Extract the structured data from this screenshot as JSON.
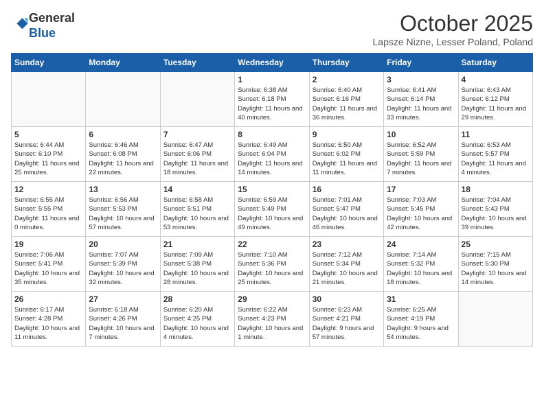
{
  "header": {
    "logo_line1": "General",
    "logo_line2": "Blue",
    "month_title": "October 2025",
    "subtitle": "Lapsze Nizne, Lesser Poland, Poland"
  },
  "weekdays": [
    "Sunday",
    "Monday",
    "Tuesday",
    "Wednesday",
    "Thursday",
    "Friday",
    "Saturday"
  ],
  "weeks": [
    [
      {
        "day": "",
        "info": ""
      },
      {
        "day": "",
        "info": ""
      },
      {
        "day": "",
        "info": ""
      },
      {
        "day": "1",
        "info": "Sunrise: 6:38 AM\nSunset: 6:18 PM\nDaylight: 11 hours\nand 40 minutes."
      },
      {
        "day": "2",
        "info": "Sunrise: 6:40 AM\nSunset: 6:16 PM\nDaylight: 11 hours\nand 36 minutes."
      },
      {
        "day": "3",
        "info": "Sunrise: 6:41 AM\nSunset: 6:14 PM\nDaylight: 11 hours\nand 33 minutes."
      },
      {
        "day": "4",
        "info": "Sunrise: 6:43 AM\nSunset: 6:12 PM\nDaylight: 11 hours\nand 29 minutes."
      }
    ],
    [
      {
        "day": "5",
        "info": "Sunrise: 6:44 AM\nSunset: 6:10 PM\nDaylight: 11 hours\nand 25 minutes."
      },
      {
        "day": "6",
        "info": "Sunrise: 6:46 AM\nSunset: 6:08 PM\nDaylight: 11 hours\nand 22 minutes."
      },
      {
        "day": "7",
        "info": "Sunrise: 6:47 AM\nSunset: 6:06 PM\nDaylight: 11 hours\nand 18 minutes."
      },
      {
        "day": "8",
        "info": "Sunrise: 6:49 AM\nSunset: 6:04 PM\nDaylight: 11 hours\nand 14 minutes."
      },
      {
        "day": "9",
        "info": "Sunrise: 6:50 AM\nSunset: 6:02 PM\nDaylight: 11 hours\nand 11 minutes."
      },
      {
        "day": "10",
        "info": "Sunrise: 6:52 AM\nSunset: 5:59 PM\nDaylight: 11 hours\nand 7 minutes."
      },
      {
        "day": "11",
        "info": "Sunrise: 6:53 AM\nSunset: 5:57 PM\nDaylight: 11 hours\nand 4 minutes."
      }
    ],
    [
      {
        "day": "12",
        "info": "Sunrise: 6:55 AM\nSunset: 5:55 PM\nDaylight: 11 hours\nand 0 minutes."
      },
      {
        "day": "13",
        "info": "Sunrise: 6:56 AM\nSunset: 5:53 PM\nDaylight: 10 hours\nand 57 minutes."
      },
      {
        "day": "14",
        "info": "Sunrise: 6:58 AM\nSunset: 5:51 PM\nDaylight: 10 hours\nand 53 minutes."
      },
      {
        "day": "15",
        "info": "Sunrise: 6:59 AM\nSunset: 5:49 PM\nDaylight: 10 hours\nand 49 minutes."
      },
      {
        "day": "16",
        "info": "Sunrise: 7:01 AM\nSunset: 5:47 PM\nDaylight: 10 hours\nand 46 minutes."
      },
      {
        "day": "17",
        "info": "Sunrise: 7:03 AM\nSunset: 5:45 PM\nDaylight: 10 hours\nand 42 minutes."
      },
      {
        "day": "18",
        "info": "Sunrise: 7:04 AM\nSunset: 5:43 PM\nDaylight: 10 hours\nand 39 minutes."
      }
    ],
    [
      {
        "day": "19",
        "info": "Sunrise: 7:06 AM\nSunset: 5:41 PM\nDaylight: 10 hours\nand 35 minutes."
      },
      {
        "day": "20",
        "info": "Sunrise: 7:07 AM\nSunset: 5:39 PM\nDaylight: 10 hours\nand 32 minutes."
      },
      {
        "day": "21",
        "info": "Sunrise: 7:09 AM\nSunset: 5:38 PM\nDaylight: 10 hours\nand 28 minutes."
      },
      {
        "day": "22",
        "info": "Sunrise: 7:10 AM\nSunset: 5:36 PM\nDaylight: 10 hours\nand 25 minutes."
      },
      {
        "day": "23",
        "info": "Sunrise: 7:12 AM\nSunset: 5:34 PM\nDaylight: 10 hours\nand 21 minutes."
      },
      {
        "day": "24",
        "info": "Sunrise: 7:14 AM\nSunset: 5:32 PM\nDaylight: 10 hours\nand 18 minutes."
      },
      {
        "day": "25",
        "info": "Sunrise: 7:15 AM\nSunset: 5:30 PM\nDaylight: 10 hours\nand 14 minutes."
      }
    ],
    [
      {
        "day": "26",
        "info": "Sunrise: 6:17 AM\nSunset: 4:28 PM\nDaylight: 10 hours\nand 11 minutes."
      },
      {
        "day": "27",
        "info": "Sunrise: 6:18 AM\nSunset: 4:26 PM\nDaylight: 10 hours\nand 7 minutes."
      },
      {
        "day": "28",
        "info": "Sunrise: 6:20 AM\nSunset: 4:25 PM\nDaylight: 10 hours\nand 4 minutes."
      },
      {
        "day": "29",
        "info": "Sunrise: 6:22 AM\nSunset: 4:23 PM\nDaylight: 10 hours\nand 1 minute."
      },
      {
        "day": "30",
        "info": "Sunrise: 6:23 AM\nSunset: 4:21 PM\nDaylight: 9 hours\nand 57 minutes."
      },
      {
        "day": "31",
        "info": "Sunrise: 6:25 AM\nSunset: 4:19 PM\nDaylight: 9 hours\nand 54 minutes."
      },
      {
        "day": "",
        "info": ""
      }
    ]
  ]
}
